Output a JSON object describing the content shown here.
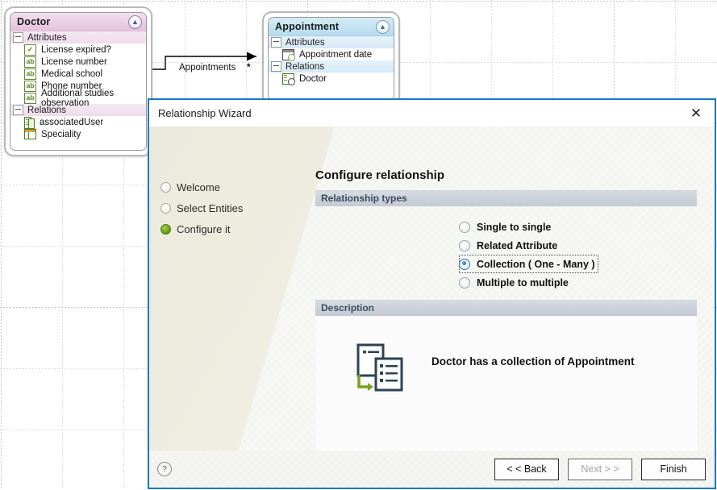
{
  "canvas": {
    "entities": [
      {
        "name": "Doctor",
        "collapse_icon": "chevron-up-double-icon",
        "groups": [
          {
            "label": "Attributes",
            "items": [
              {
                "label": "License expired?",
                "icon": "boolean-attribute-icon"
              },
              {
                "label": "License number",
                "icon": "text-attribute-icon"
              },
              {
                "label": "Medical school",
                "icon": "text-attribute-icon"
              },
              {
                "label": "Phone number",
                "icon": "text-attribute-icon"
              },
              {
                "label": "Additional studies observation",
                "icon": "text-attribute-icon"
              }
            ]
          },
          {
            "label": "Relations",
            "items": [
              {
                "label": "associatedUser",
                "icon": "relation-icon"
              },
              {
                "label": "Speciality",
                "icon": "table-relation-icon"
              }
            ]
          }
        ]
      },
      {
        "name": "Appointment",
        "collapse_icon": "chevron-up-double-icon",
        "groups": [
          {
            "label": "Attributes",
            "items": [
              {
                "label": "Appointment date",
                "icon": "datetime-attribute-icon"
              }
            ]
          },
          {
            "label": "Relations",
            "items": [
              {
                "label": "Doctor",
                "icon": "relation-icon"
              }
            ]
          }
        ]
      }
    ],
    "connector": {
      "label": "Appointments",
      "multiplicity": "*"
    }
  },
  "dialog": {
    "title": "Relationship Wizard",
    "close_label": "✕",
    "steps": [
      {
        "label": "Welcome",
        "active": false
      },
      {
        "label": "Select Entities",
        "active": false
      },
      {
        "label": "Configure it",
        "active": true
      }
    ],
    "heading": "Configure relationship",
    "sections": {
      "types_header": "Relationship types",
      "description_header": "Description"
    },
    "relationship_types": [
      {
        "label": "Single to single",
        "selected": false
      },
      {
        "label": "Related Attribute",
        "selected": false
      },
      {
        "label": "Collection ( One - Many )",
        "selected": true
      },
      {
        "label": "Multiple to multiple",
        "selected": false
      }
    ],
    "description": {
      "icon": "collection-relationship-icon",
      "text": "Doctor has a collection of Appointment"
    },
    "footer": {
      "help_label": "?",
      "back_label": "< < Back",
      "next_label": "Next > >",
      "finish_label": "Finish",
      "next_disabled": true
    }
  }
}
